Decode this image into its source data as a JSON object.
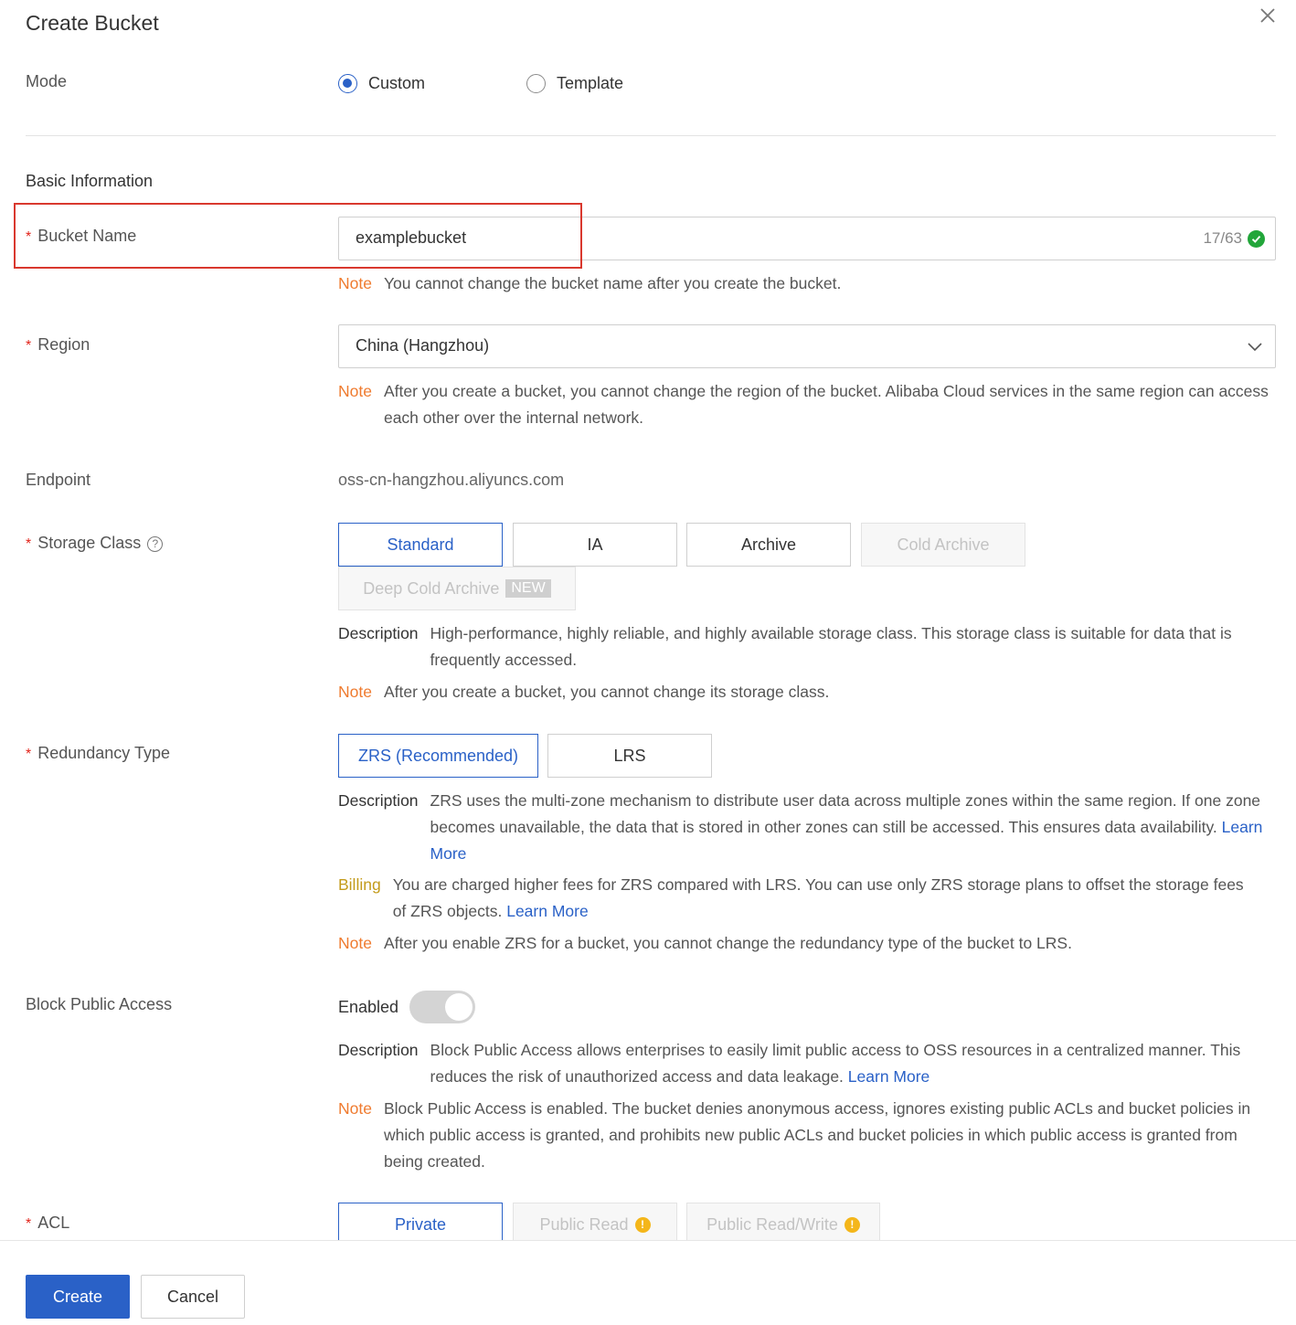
{
  "dialog": {
    "title": "Create Bucket"
  },
  "mode": {
    "label": "Mode",
    "options": [
      {
        "label": "Custom",
        "selected": true
      },
      {
        "label": "Template",
        "selected": false
      }
    ]
  },
  "basic_info": {
    "heading": "Basic Information"
  },
  "bucket_name": {
    "label": "Bucket Name",
    "value": "examplebucket",
    "counter": "17/63",
    "note_tag": "Note",
    "note": "You cannot change the bucket name after you create the bucket."
  },
  "region": {
    "label": "Region",
    "value": "China (Hangzhou)",
    "note_tag": "Note",
    "note": "After you create a bucket, you cannot change the region of the bucket. Alibaba Cloud services in the same region can access each other over the internal network."
  },
  "endpoint": {
    "label": "Endpoint",
    "value": "oss-cn-hangzhou.aliyuncs.com"
  },
  "storage_class": {
    "label": "Storage Class",
    "options": [
      {
        "label": "Standard",
        "state": "selected"
      },
      {
        "label": "IA",
        "state": "normal"
      },
      {
        "label": "Archive",
        "state": "normal"
      },
      {
        "label": "Cold Archive",
        "state": "disabled"
      },
      {
        "label": "Deep Cold Archive",
        "state": "disabled",
        "badge": "NEW"
      }
    ],
    "description_tag": "Description",
    "description": "High-performance, highly reliable, and highly available storage class. This storage class is suitable for data that is frequently accessed.",
    "note_tag": "Note",
    "note": "After you create a bucket, you cannot change its storage class."
  },
  "redundancy": {
    "label": "Redundancy Type",
    "options": [
      {
        "label": "ZRS (Recommended)",
        "state": "selected"
      },
      {
        "label": "LRS",
        "state": "normal"
      }
    ],
    "description_tag": "Description",
    "description": "ZRS uses the multi-zone mechanism to distribute user data across multiple zones within the same region. If one zone becomes unavailable, the data that is stored in other zones can still be accessed. This ensures data availability.",
    "description_link": "Learn More",
    "billing_tag": "Billing",
    "billing": "You are charged higher fees for ZRS compared with LRS. You can use only ZRS storage plans to offset the storage fees of ZRS objects.",
    "billing_link": "Learn More",
    "note_tag": "Note",
    "note": "After you enable ZRS for a bucket, you cannot change the redundancy type of the bucket to LRS."
  },
  "block_public_access": {
    "label": "Block Public Access",
    "switch_label": "Enabled",
    "enabled": true,
    "description_tag": "Description",
    "description": "Block Public Access allows enterprises to easily limit public access to OSS resources in a centralized manner. This reduces the risk of unauthorized access and data leakage.",
    "description_link": "Learn More",
    "note_tag": "Note",
    "note": "Block Public Access is enabled. The bucket denies anonymous access, ignores existing public ACLs and bucket policies in which public access is granted, and prohibits new public ACLs and bucket policies in which public access is granted from being created."
  },
  "acl": {
    "label": "ACL",
    "options": [
      {
        "label": "Private",
        "state": "selected"
      },
      {
        "label": "Public Read",
        "state": "disabled",
        "icon": "warning-icon"
      },
      {
        "label": "Public Read/Write",
        "state": "disabled",
        "icon": "warning-icon"
      }
    ]
  },
  "footer": {
    "create_label": "Create",
    "cancel_label": "Cancel"
  },
  "colors": {
    "primary": "#2a61c7",
    "note": "#ef7b2f",
    "billing": "#c39b1b",
    "required": "#e2231a",
    "success": "#22a63a",
    "highlight": "#d9382e"
  }
}
